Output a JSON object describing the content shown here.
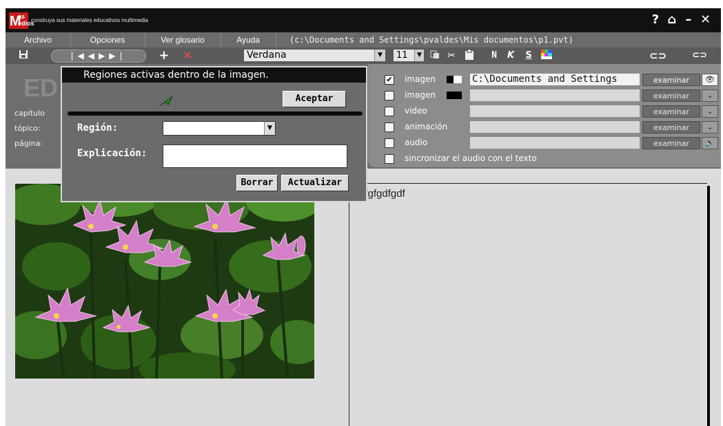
{
  "app": {
    "logo_text_line1": "as",
    "logo_text_line2": "edios",
    "logo_letter": "M",
    "subtitle": "construya sus materiales educativos multimedia",
    "window_controls": [
      "?",
      "⌂",
      "–",
      "✕"
    ]
  },
  "menu": {
    "items": [
      "Archivo",
      "Opciones",
      "Ver glosario",
      "Ayuda"
    ],
    "file_path": "(c:\\Documents and Settings\\pvaldes\\Mis documentos\\p1.pvt)"
  },
  "toolbar": {
    "font_name": "Verdana",
    "font_size": "11",
    "bold_label": "N",
    "italic_label": "K",
    "underline_label": "S"
  },
  "editor_header": {
    "title_partial": "ED",
    "capitulo_label": "capítulo",
    "topico_label": "tópico:",
    "pagina_label": "página:"
  },
  "media": {
    "rows": [
      {
        "label": "imagen",
        "checked": true,
        "path": "C:\\Documents and Settings",
        "button": "examinar"
      },
      {
        "label": "imagen",
        "checked": false,
        "path": "",
        "button": "examinar"
      },
      {
        "label": "video",
        "checked": false,
        "path": "",
        "button": "examinar"
      },
      {
        "label": "animación",
        "checked": false,
        "path": "",
        "button": "examinar"
      },
      {
        "label": "audio",
        "checked": false,
        "path": "",
        "button": "examinar"
      }
    ],
    "sync_label": "sincronizar el audio con el texto",
    "sync_checked": false
  },
  "content": {
    "body_text": "dfgfgdfgdf"
  },
  "dialog": {
    "title": "Regiones activas dentro de la imagen.",
    "accept_button": "Aceptar",
    "region_label": "Región:",
    "region_value": "",
    "explanation_label": "Explicación:",
    "explanation_value": "",
    "delete_button": "Borrar",
    "update_button": "Actualizar"
  }
}
